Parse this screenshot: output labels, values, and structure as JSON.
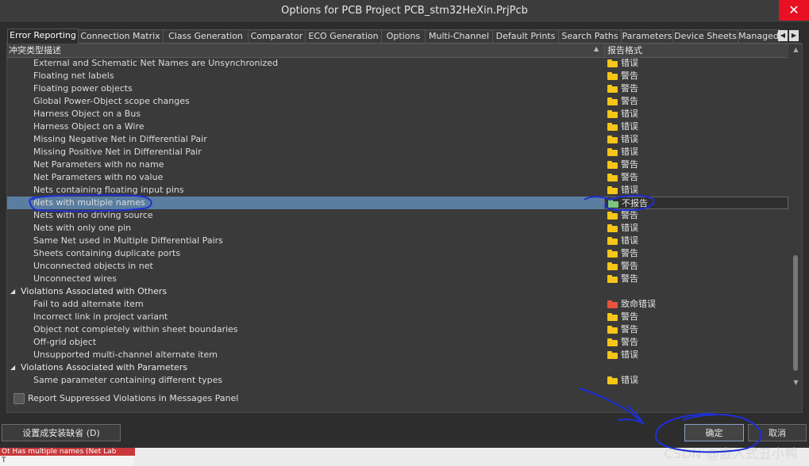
{
  "window": {
    "title": "Options for PCB Project PCB_stm32HeXin.PrjPcb",
    "close_glyph": "✕"
  },
  "tabs": [
    {
      "label": "Error Reporting",
      "active": true
    },
    {
      "label": "Connection Matrix"
    },
    {
      "label": "Class Generation"
    },
    {
      "label": "Comparator"
    },
    {
      "label": "ECO Generation"
    },
    {
      "label": "Options"
    },
    {
      "label": "Multi-Channel"
    },
    {
      "label": "Default Prints"
    },
    {
      "label": "Search Paths"
    },
    {
      "label": "Parameters"
    },
    {
      "label": "Device Sheets"
    },
    {
      "label": "Managed"
    }
  ],
  "table": {
    "col_desc": "冲突类型描述",
    "col_report": "报告格式",
    "rows": [
      {
        "kind": "item",
        "label": "External and Schematic Net Names are Unsynchronized",
        "report": "错误",
        "color": "#f5c518"
      },
      {
        "kind": "item",
        "label": "Floating net labels",
        "report": "警告",
        "color": "#f5c518"
      },
      {
        "kind": "item",
        "label": "Floating power objects",
        "report": "警告",
        "color": "#f5c518"
      },
      {
        "kind": "item",
        "label": "Global Power-Object scope changes",
        "report": "警告",
        "color": "#f5c518"
      },
      {
        "kind": "item",
        "label": "Harness Object on a Bus",
        "report": "错误",
        "color": "#f5c518"
      },
      {
        "kind": "item",
        "label": "Harness Object on a Wire",
        "report": "错误",
        "color": "#f5c518"
      },
      {
        "kind": "item",
        "label": "Missing Negative Net in Differential Pair",
        "report": "错误",
        "color": "#f5c518"
      },
      {
        "kind": "item",
        "label": "Missing Positive Net in Differential Pair",
        "report": "错误",
        "color": "#f5c518"
      },
      {
        "kind": "item",
        "label": "Net Parameters with no name",
        "report": "警告",
        "color": "#f5c518"
      },
      {
        "kind": "item",
        "label": "Net Parameters with no value",
        "report": "警告",
        "color": "#f5c518"
      },
      {
        "kind": "item",
        "label": "Nets containing floating input pins",
        "report": "错误",
        "color": "#f5c518"
      },
      {
        "kind": "item",
        "label": "Nets with multiple names",
        "report": "不报告",
        "color": "#7cc47f",
        "selected": true
      },
      {
        "kind": "item",
        "label": "Nets with no driving source",
        "report": "警告",
        "color": "#f5c518"
      },
      {
        "kind": "item",
        "label": "Nets with only one pin",
        "report": "错误",
        "color": "#f5c518"
      },
      {
        "kind": "item",
        "label": "Same Net used in Multiple Differential Pairs",
        "report": "错误",
        "color": "#f5c518"
      },
      {
        "kind": "item",
        "label": "Sheets containing duplicate ports",
        "report": "警告",
        "color": "#f5c518"
      },
      {
        "kind": "item",
        "label": "Unconnected objects in net",
        "report": "警告",
        "color": "#f5c518"
      },
      {
        "kind": "item",
        "label": "Unconnected wires",
        "report": "警告",
        "color": "#f5c518"
      },
      {
        "kind": "group",
        "label": "Violations Associated with Others"
      },
      {
        "kind": "item",
        "label": "Fail to add alternate item",
        "report": "致命错误",
        "color": "#e8533e"
      },
      {
        "kind": "item",
        "label": "Incorrect link in project variant",
        "report": "警告",
        "color": "#f5c518"
      },
      {
        "kind": "item",
        "label": "Object not completely within sheet boundaries",
        "report": "警告",
        "color": "#f5c518"
      },
      {
        "kind": "item",
        "label": "Off-grid object",
        "report": "警告",
        "color": "#f5c518"
      },
      {
        "kind": "item",
        "label": "Unsupported multi-channel alternate item",
        "report": "错误",
        "color": "#f5c518"
      },
      {
        "kind": "group",
        "label": "Violations Associated with Parameters"
      },
      {
        "kind": "item",
        "label": "Same parameter containing different types",
        "report": "错误",
        "color": "#f5c518"
      }
    ]
  },
  "checkbox": {
    "label": "Report Suppressed Violations in Messages Panel",
    "checked": false
  },
  "buttons": {
    "defaults": "设置成安装缺省 (D)",
    "ok": "确定",
    "cancel": "取消"
  },
  "background": {
    "message_snippet": "Ot Has multiple names (Net Lab",
    "message_t": "T"
  },
  "watermark": "CSDN @嵌入式丑小鸭"
}
